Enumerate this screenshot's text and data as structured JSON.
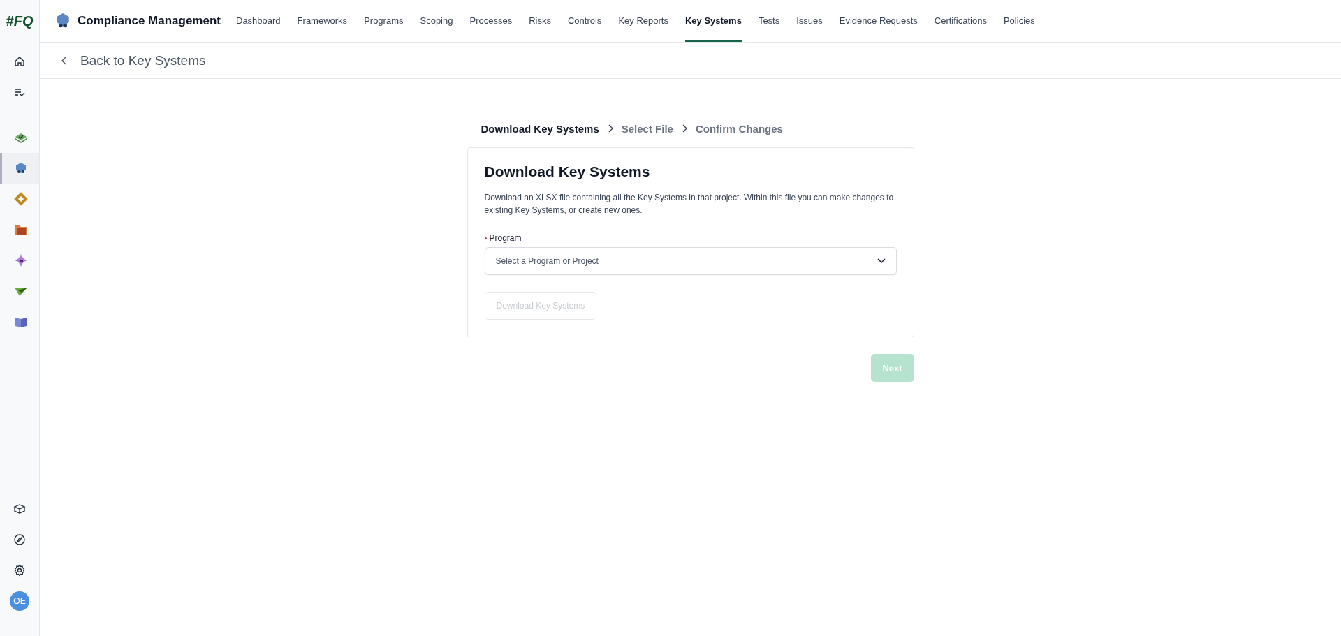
{
  "sidebar": {
    "logo": "#FQ",
    "top_items": [
      {
        "kind": "home"
      },
      {
        "kind": "tasks"
      }
    ],
    "apps": [
      {
        "kind": "layers",
        "selected": false
      },
      {
        "kind": "badge",
        "selected": true
      },
      {
        "kind": "ring",
        "selected": false
      },
      {
        "kind": "folder",
        "selected": false
      },
      {
        "kind": "star",
        "selected": false
      },
      {
        "kind": "plane",
        "selected": false
      },
      {
        "kind": "book",
        "selected": false
      }
    ],
    "bottom_items": [
      {
        "kind": "box"
      },
      {
        "kind": "compass"
      },
      {
        "kind": "settings"
      }
    ],
    "avatar": "OE"
  },
  "header": {
    "app_title": "Compliance Management",
    "tabs": [
      {
        "label": "Dashboard",
        "selected": false
      },
      {
        "label": "Frameworks",
        "selected": false
      },
      {
        "label": "Programs",
        "selected": false
      },
      {
        "label": "Scoping",
        "selected": false
      },
      {
        "label": "Processes",
        "selected": false
      },
      {
        "label": "Risks",
        "selected": false
      },
      {
        "label": "Controls",
        "selected": false
      },
      {
        "label": "Key Reports",
        "selected": false
      },
      {
        "label": "Key Systems",
        "selected": true
      },
      {
        "label": "Tests",
        "selected": false
      },
      {
        "label": "Issues",
        "selected": false
      },
      {
        "label": "Evidence Requests",
        "selected": false
      },
      {
        "label": "Certifications",
        "selected": false
      },
      {
        "label": "Policies",
        "selected": false
      }
    ]
  },
  "back_link": "Back to Key Systems",
  "steps": [
    {
      "label": "Download Key Systems",
      "selected": true
    },
    {
      "label": "Select File",
      "selected": false
    },
    {
      "label": "Confirm Changes",
      "selected": false
    }
  ],
  "card": {
    "title": "Download Key Systems",
    "description": "Download an XLSX file containing all the Key Systems in that project. Within this file you can make changes to existing Key Systems, or create new ones.",
    "field": {
      "label": "Program",
      "required": true,
      "placeholder": "Select a Program or Project"
    },
    "download_button": {
      "label": "Download Key Systems",
      "disabled": true
    }
  },
  "next_button": {
    "label": "Next",
    "disabled": true
  }
}
